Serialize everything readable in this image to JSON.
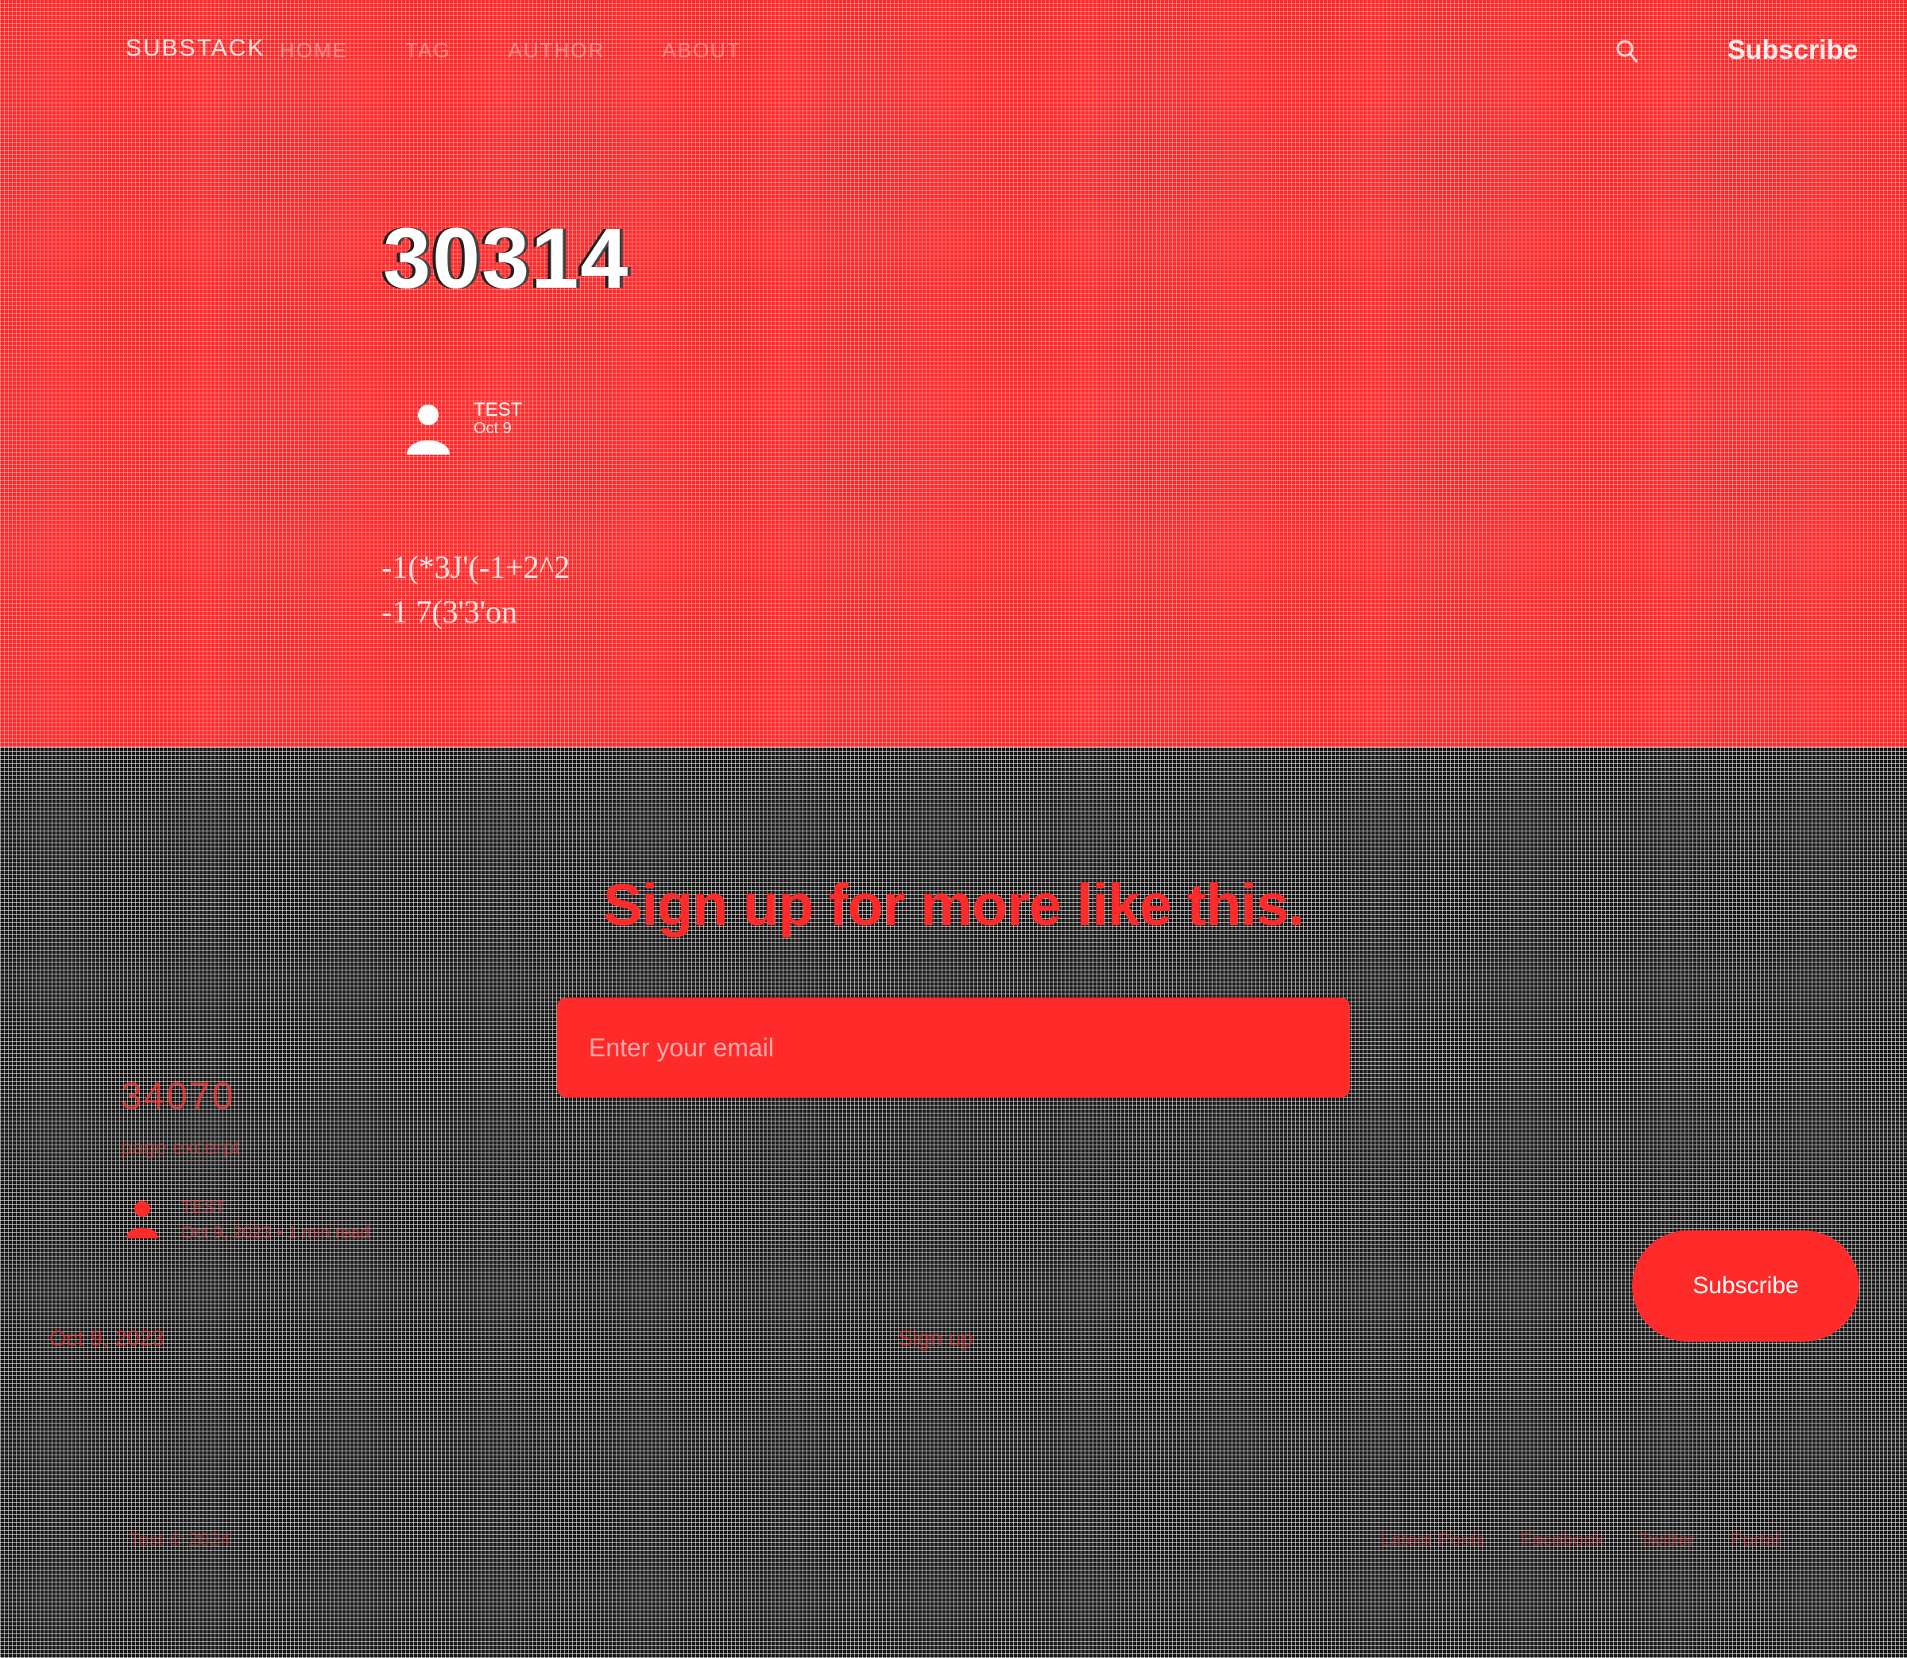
{
  "header": {
    "brand": "SUBSTACK",
    "nav": [
      "HOME",
      "TAG",
      "AUTHOR",
      "ABOUT"
    ],
    "subscribe_label": "Subscribe"
  },
  "post": {
    "title": "30314",
    "author": "TEST",
    "date": "Oct 9",
    "body_lines": [
      "-1(*3J'(-1+2^2",
      "-1 7(3'3'on"
    ]
  },
  "signup": {
    "heading": "Sign up for more like this.",
    "email_placeholder": "Enter your email",
    "button_label": "Subscribe"
  },
  "related": {
    "title": "34070",
    "excerpt": "page excerpt",
    "author": "TEST",
    "date": "Oct 9, 2023",
    "reading_time": "1 min read"
  },
  "left_link": "Oct 9, 2023",
  "mid_link": "Sign up",
  "footer": {
    "copyright": "Test © 2024",
    "links": [
      "Latest Posts",
      "Facebook",
      "Twitter",
      "Portal"
    ]
  },
  "colors": {
    "accent": "#ff2a2a",
    "background": "#1a1a1a",
    "text_on_accent": "#ffffff"
  },
  "icons": {
    "author": "user-avatar-icon",
    "search": "search-icon"
  }
}
